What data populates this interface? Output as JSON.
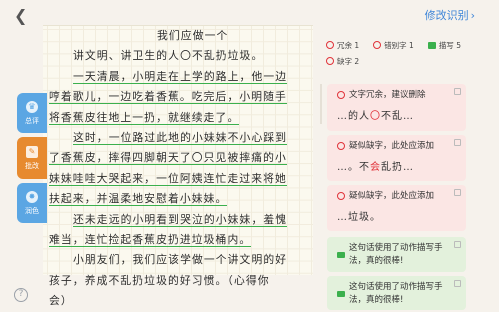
{
  "top": {
    "back_icon": "back-icon",
    "edit_label": "修改识别",
    "edit_chevron": "›"
  },
  "essay": {
    "title": "我们应做一个",
    "lines": [
      "讲文明、讲卫生的人〇不乱扔垃圾。",
      "一天清晨，小明走在上学的路上，他一边",
      "哼着歌儿，一边吃着香蕉。吃完后，小明随手",
      "将香蕉皮往地上一扔，就继续走了。",
      "这时，一位路过此地的小妹妹不小心踩到",
      "了香蕉皮，摔得四脚朝天了〇只见被摔痛的小",
      "妹妹哇哇大哭起来，一位阿姨连忙走过来将她",
      "扶起来，并温柔地安慰着小妹妹。",
      "还未走远的小明看到哭泣的小妹妹，羞愧",
      "难当，连忙捡起香蕉皮扔进垃圾桶内。",
      "小朋友们，我们应该学做一个讲文明的好",
      "孩子，养成不乱扔垃圾的好习惯。（心得你",
      "会）"
    ]
  },
  "side_tabs": [
    {
      "label": "总评",
      "icon": "trophy-icon"
    },
    {
      "label": "批改",
      "icon": "edit-icon"
    },
    {
      "label": "润色",
      "icon": "brush-icon"
    }
  ],
  "help_icon": "?",
  "legend": {
    "redundant": "冗余 1",
    "typo": "错别字 1",
    "description": "描写 5",
    "missing": "缺字 2"
  },
  "cards": [
    {
      "title": "文字冗余，建议删除",
      "example_pre": "…的人",
      "example_mark": "〇",
      "example_post": "不乱…"
    },
    {
      "title": "疑似缺字，此处应添加",
      "example_pre": "…。不",
      "example_mark": "会",
      "example_post": "乱扔…"
    },
    {
      "title": "疑似缺字，此处应添加",
      "example_pre": "…垃圾。",
      "example_mark": "",
      "example_post": ""
    },
    {
      "text": "这句话使用了动作描写手法，真的很棒!"
    },
    {
      "text": "这句话使用了动作描写手法，真的很棒!"
    }
  ],
  "colors": {
    "accent_blue": "#3f86d8",
    "tab_blue": "#5ba6e3",
    "tab_orange": "#e78a2f",
    "mark_red": "#e0333a",
    "mark_green": "#3bb04d"
  }
}
